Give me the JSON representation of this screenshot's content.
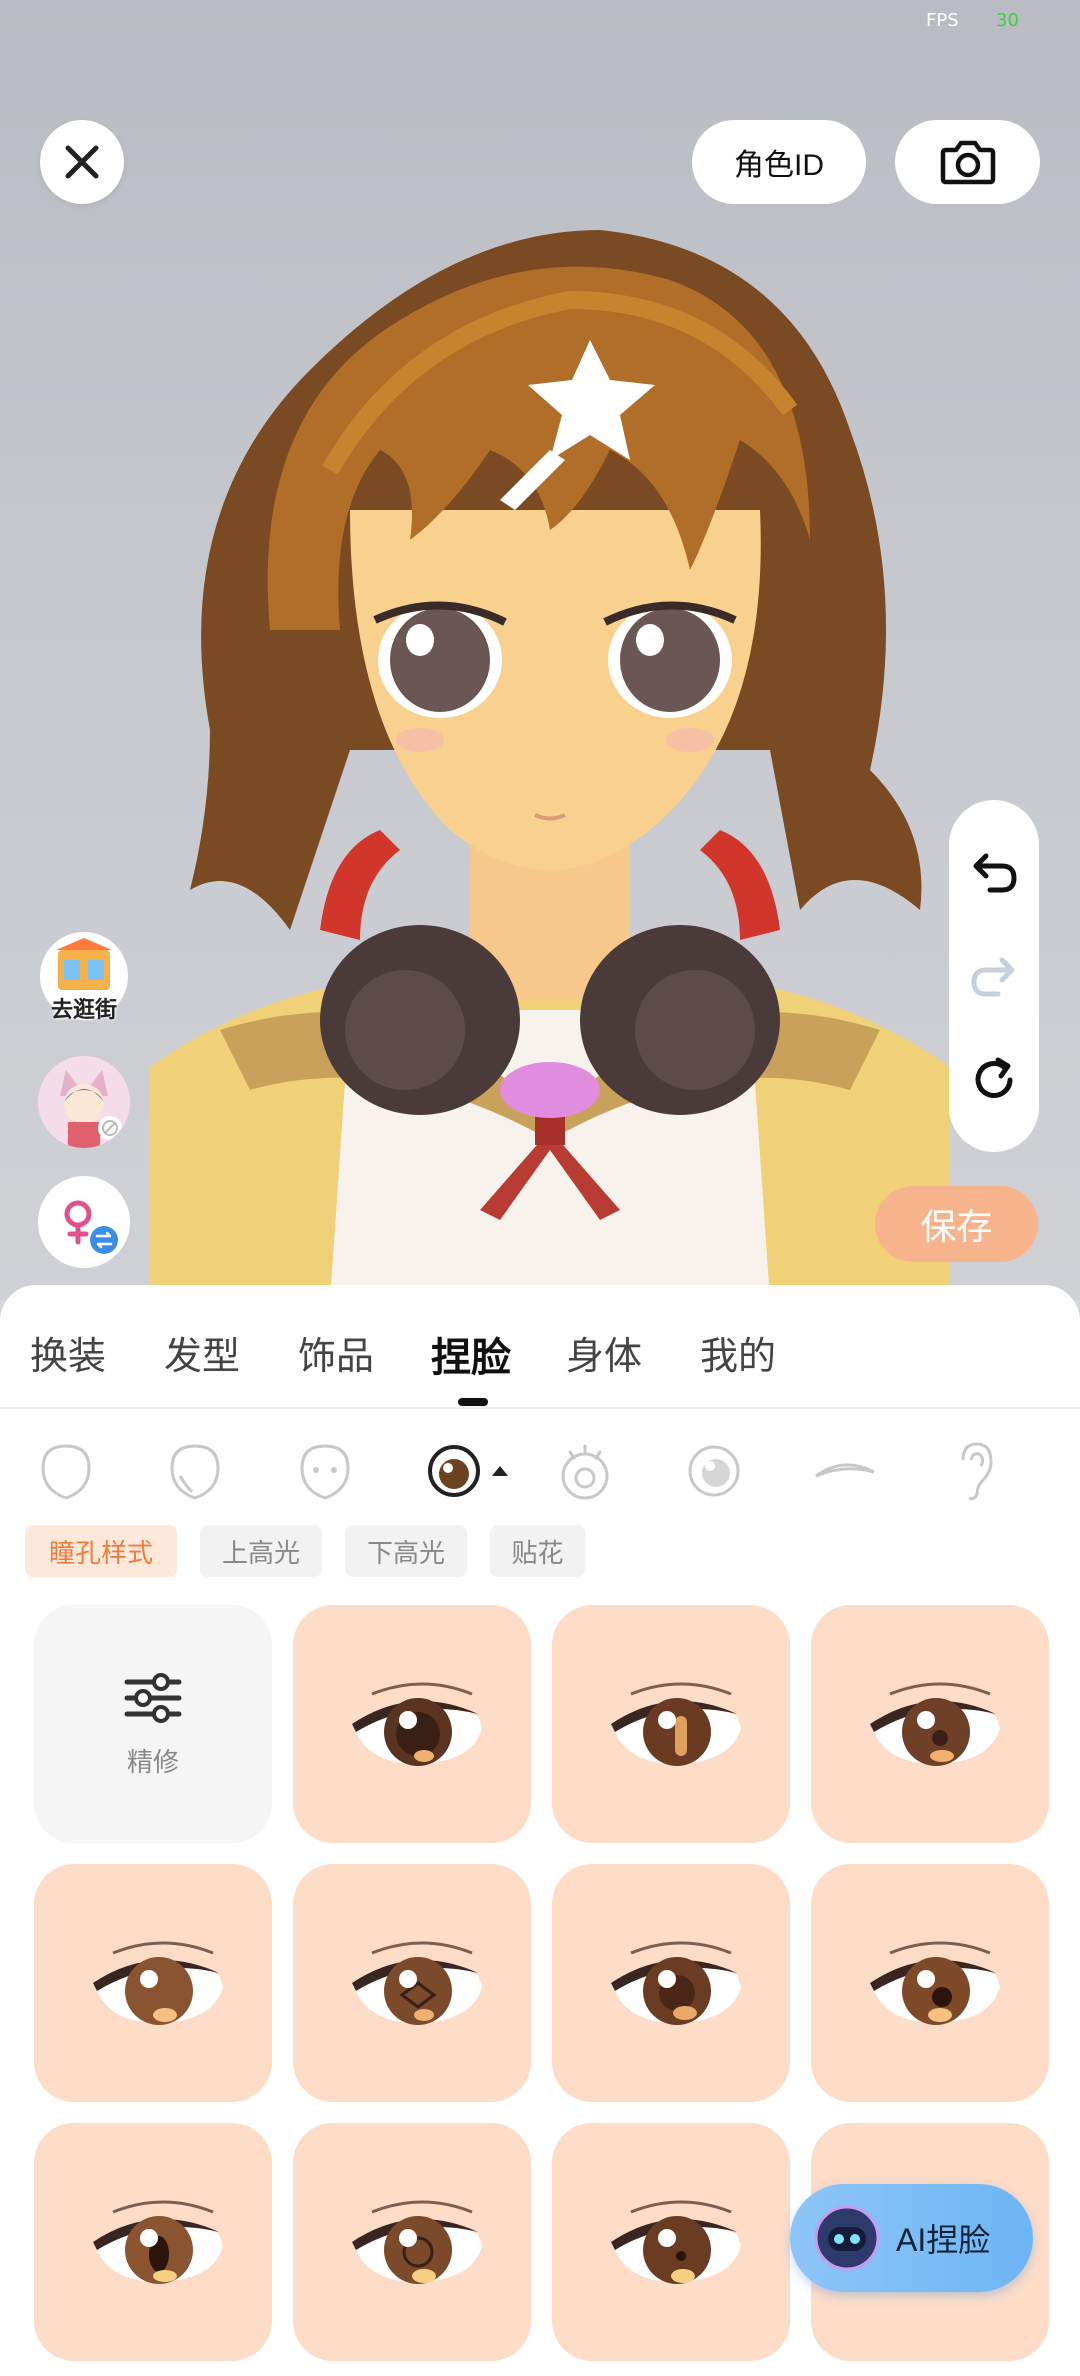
{
  "status": {
    "fps_label": "FPS",
    "fps_value": "30"
  },
  "toolbar": {
    "role_id_label": "角色ID"
  },
  "side": {
    "shop_label": "去逛街"
  },
  "actions": {
    "save_label": "保存",
    "ai_label": "AI捏脸"
  },
  "tabs": [
    {
      "label": "换装"
    },
    {
      "label": "发型"
    },
    {
      "label": "饰品"
    },
    {
      "label": "捏脸",
      "active": true
    },
    {
      "label": "身体"
    },
    {
      "label": "我的"
    }
  ],
  "face_parts": [
    {
      "icon": "face-shape-icon"
    },
    {
      "icon": "face-side-icon"
    },
    {
      "icon": "face-front-icon"
    },
    {
      "icon": "eye-icon",
      "active": true
    },
    {
      "icon": "eye-lash-icon"
    },
    {
      "icon": "eye-highlight-icon"
    },
    {
      "icon": "eyebrow-icon"
    },
    {
      "icon": "ear-icon"
    }
  ],
  "subtabs": [
    {
      "label": "瞳孔样式",
      "active": true
    },
    {
      "label": "上高光"
    },
    {
      "label": "下高光"
    },
    {
      "label": "贴花"
    }
  ],
  "grid": {
    "refine_label": "精修",
    "items_count": 11
  },
  "colors": {
    "accent": "#f07c3a",
    "save_bg": "#f7b48c",
    "tile_bg": "#fddcc8",
    "ai_button": "#7bbef6"
  }
}
